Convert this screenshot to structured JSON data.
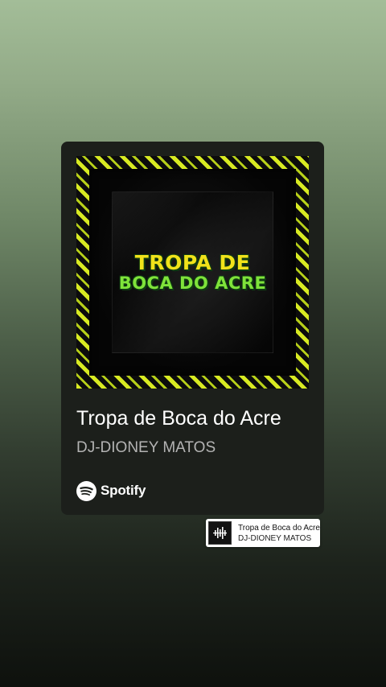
{
  "card": {
    "artwork": {
      "line1": "TROPA DE",
      "line2": "BOCA DO ACRE"
    },
    "title": "Tropa de Boca do Acre",
    "artist": "DJ-DIONEY MATOS",
    "brand": {
      "icon": "spotify-icon",
      "label": "Spotify"
    }
  },
  "sticker": {
    "icon": "sound-wave-icon",
    "title": "Tropa de Boca do Acre",
    "artist": "DJ-DIONEY MATOS"
  },
  "colors": {
    "card_bg": "#1c1f1b",
    "accent_yellow": "#f0e21a",
    "accent_green": "#7fe33a"
  }
}
